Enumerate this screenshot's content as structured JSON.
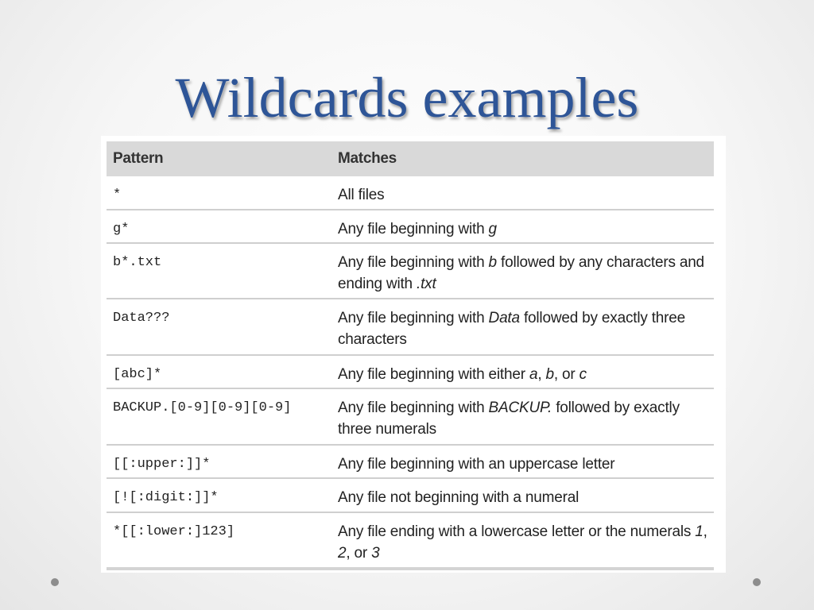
{
  "slide": {
    "title": "Wildcards examples"
  },
  "table": {
    "headers": {
      "pattern": "Pattern",
      "matches": "Matches"
    },
    "rows": [
      {
        "pattern": "*",
        "match": [
          {
            "t": "All files"
          }
        ]
      },
      {
        "pattern": "g*",
        "match": [
          {
            "t": "Any file beginning with "
          },
          {
            "t": "g",
            "i": true
          }
        ]
      },
      {
        "pattern": "b*.txt",
        "match": [
          {
            "t": "Any file beginning with "
          },
          {
            "t": "b",
            "i": true
          },
          {
            "t": " followed by any characters and ending with "
          },
          {
            "t": ".txt",
            "i": true
          }
        ]
      },
      {
        "pattern": "Data???",
        "match": [
          {
            "t": "Any file beginning with "
          },
          {
            "t": "Data",
            "i": true
          },
          {
            "t": " followed by exactly three characters"
          }
        ]
      },
      {
        "pattern": "[abc]*",
        "match": [
          {
            "t": "Any file beginning with either "
          },
          {
            "t": "a",
            "i": true
          },
          {
            "t": ", "
          },
          {
            "t": "b",
            "i": true
          },
          {
            "t": ", or "
          },
          {
            "t": "c",
            "i": true
          }
        ]
      },
      {
        "pattern": "BACKUP.[0-9][0-9][0-9]",
        "match": [
          {
            "t": "Any file beginning with "
          },
          {
            "t": "BACKUP.",
            "i": true
          },
          {
            "t": " followed by exactly three numerals"
          }
        ]
      },
      {
        "pattern": "[[:upper:]]*",
        "match": [
          {
            "t": "Any file beginning with an uppercase letter"
          }
        ]
      },
      {
        "pattern": "[![:digit:]]*",
        "match": [
          {
            "t": "Any file not beginning with a numeral"
          }
        ]
      },
      {
        "pattern": "*[[:lower:]123]",
        "match": [
          {
            "t": "Any file ending with a lowercase letter or the numerals "
          },
          {
            "t": "1",
            "i": true
          },
          {
            "t": ", "
          },
          {
            "t": "2",
            "i": true
          },
          {
            "t": ", or "
          },
          {
            "t": "3",
            "i": true
          }
        ]
      }
    ]
  },
  "colors": {
    "title": "#2e5597",
    "header_bg": "#d9d9d9",
    "row_divider": "#cfcfcf"
  }
}
